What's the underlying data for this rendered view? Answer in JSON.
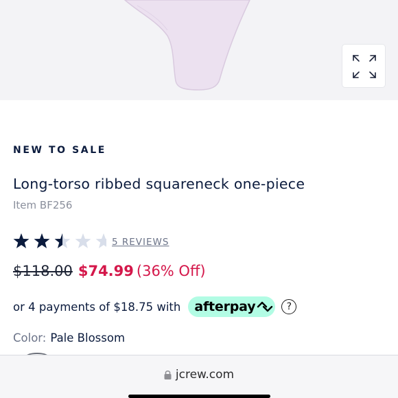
{
  "product": {
    "badge": "NEW TO SALE",
    "title": "Long-torso ribbed squareneck one-piece",
    "item_number": "Item BF256",
    "rating": {
      "value": 2.5,
      "max": 5,
      "reviews_label": "5 REVIEWS"
    },
    "price": {
      "original": "$118.00",
      "sale": "$74.99",
      "discount": "(36% Off)"
    },
    "afterpay": {
      "text": "or 4 payments of $18.75 with",
      "brand": "afterpay",
      "info_icon": "?"
    },
    "color": {
      "label": "Color:",
      "value": "Pale Blossom"
    }
  },
  "browser": {
    "url": "jcrew.com"
  },
  "colors": {
    "navy": "#0b1b3d",
    "sale_red": "#d4174a",
    "afterpay_mint": "#b2fce4",
    "star_empty": "#d8deea",
    "garment": "#ece1f0"
  },
  "icons": {
    "expand": "expand-arrows-icon",
    "lock": "lock-icon",
    "info": "info-circle-icon"
  }
}
